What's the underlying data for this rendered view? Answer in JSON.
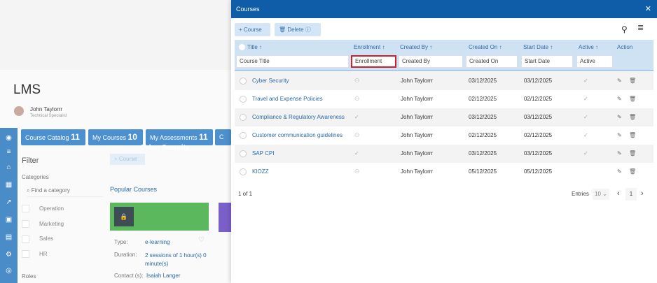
{
  "lms": {
    "title": "LMS",
    "user": {
      "name": "John Taylorrr",
      "role": "Technical Specialist"
    },
    "tabs": [
      {
        "label": "Course Catalog",
        "count": "11"
      },
      {
        "label": "My Courses",
        "count": "10"
      },
      {
        "label": "My Assessments",
        "count": "11"
      },
      {
        "label": "C",
        "count": ""
      }
    ],
    "filter": {
      "title": "Filter",
      "categories_label": "Categories",
      "search_placeholder": "Find a category",
      "categories": [
        "Operation",
        "Marketing",
        "Sales",
        "HR"
      ],
      "roles_label": "Roles"
    },
    "add_course": "+ Course",
    "popular_label": "Popular Courses",
    "card": {
      "title": "Cyber Security",
      "type_label": "Type:",
      "type": "e-learning",
      "duration_label": "Duration:",
      "duration": "2 sessions of 1 hour(s) 0 minute(s)",
      "contact_label": "Contact (s):",
      "contact": "Isaiah Langer"
    }
  },
  "modal": {
    "title": "Courses",
    "close": "✕",
    "toolbar": {
      "add": "+ Course",
      "delete": "Delete"
    },
    "columns": [
      "Title ↑",
      "Enrollment ↑",
      "Created By ↑",
      "Created On ↑",
      "Start Date ↑",
      "Active ↑",
      "Action"
    ],
    "filters": [
      "Course Title",
      "Enrollment",
      "Created By",
      "Created On",
      "Start Date",
      "Active"
    ],
    "rows": [
      {
        "title": "Cyber Security",
        "enrollment": "group",
        "created_by": "John Taylorrr",
        "created_on": "03/12/2025",
        "start_date": "03/12/2025",
        "active": true
      },
      {
        "title": "Travel and Expense Policies",
        "enrollment": "group",
        "created_by": "John Taylorrr",
        "created_on": "02/12/2025",
        "start_date": "02/12/2025",
        "active": true
      },
      {
        "title": "Compliance & Regulatory Awareness",
        "enrollment": "check",
        "created_by": "John Taylorrr",
        "created_on": "03/12/2025",
        "start_date": "03/12/2025",
        "active": true
      },
      {
        "title": "Customer communication guidelines",
        "enrollment": "group",
        "created_by": "John Taylorrr",
        "created_on": "02/12/2025",
        "start_date": "02/12/2025",
        "active": true
      },
      {
        "title": "SAP CPI",
        "enrollment": "check",
        "created_by": "John Taylorrr",
        "created_on": "03/12/2025",
        "start_date": "03/12/2025",
        "active": true
      },
      {
        "title": "KIOZZ",
        "enrollment": "group",
        "created_by": "John Taylorrr",
        "created_on": "05/12/2025",
        "start_date": "05/12/2025",
        "active": false
      }
    ],
    "footer": {
      "page_info": "1 of 1",
      "entries_label": "Entries",
      "entries": "10",
      "page": "1"
    }
  }
}
